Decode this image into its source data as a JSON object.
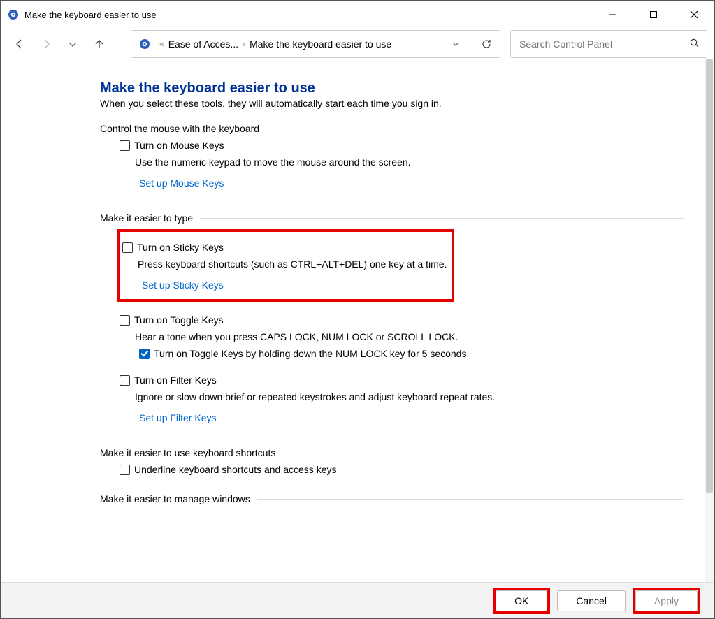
{
  "titlebar": {
    "title": "Make the keyboard easier to use"
  },
  "breadcrumb": {
    "item1": "Ease of Acces...",
    "item2": "Make the keyboard easier to use"
  },
  "search": {
    "placeholder": "Search Control Panel"
  },
  "page": {
    "title": "Make the keyboard easier to use",
    "subtitle": "When you select these tools, they will automatically start each time you sign in."
  },
  "sections": {
    "mouse": {
      "heading": "Control the mouse with the keyboard",
      "opt_label": "Turn on Mouse Keys",
      "opt_desc": "Use the numeric keypad to move the mouse around the screen.",
      "link": "Set up Mouse Keys"
    },
    "type": {
      "heading": "Make it easier to type",
      "sticky_label": "Turn on Sticky Keys",
      "sticky_desc": "Press keyboard shortcuts (such as CTRL+ALT+DEL) one key at a time.",
      "sticky_link": "Set up Sticky Keys",
      "toggle_label": "Turn on Toggle Keys",
      "toggle_desc": "Hear a tone when you press CAPS LOCK, NUM LOCK or SCROLL LOCK.",
      "toggle_sub": "Turn on Toggle Keys by holding down the NUM LOCK key for 5 seconds",
      "filter_label": "Turn on Filter Keys",
      "filter_desc": "Ignore or slow down brief or repeated keystrokes and adjust keyboard repeat rates.",
      "filter_link": "Set up Filter Keys"
    },
    "shortcuts": {
      "heading": "Make it easier to use keyboard shortcuts",
      "underline_label": "Underline keyboard shortcuts and access keys"
    },
    "windows": {
      "heading": "Make it easier to manage windows"
    }
  },
  "buttons": {
    "ok": "OK",
    "cancel": "Cancel",
    "apply": "Apply"
  }
}
